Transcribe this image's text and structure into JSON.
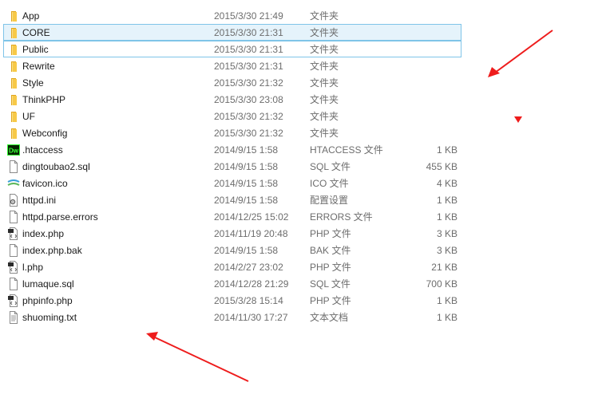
{
  "files": [
    {
      "name": "App",
      "date": "2015/3/30 21:49",
      "type": "文件夹",
      "size": "",
      "icon": "folder-icon"
    },
    {
      "name": "CORE",
      "date": "2015/3/30 21:31",
      "type": "文件夹",
      "size": "",
      "icon": "folder-icon",
      "state": "selected"
    },
    {
      "name": "Public",
      "date": "2015/3/30 21:31",
      "type": "文件夹",
      "size": "",
      "icon": "folder-icon",
      "state": "focused"
    },
    {
      "name": "Rewrite",
      "date": "2015/3/30 21:31",
      "type": "文件夹",
      "size": "",
      "icon": "folder-icon"
    },
    {
      "name": "Style",
      "date": "2015/3/30 21:32",
      "type": "文件夹",
      "size": "",
      "icon": "folder-icon"
    },
    {
      "name": "ThinkPHP",
      "date": "2015/3/30 23:08",
      "type": "文件夹",
      "size": "",
      "icon": "folder-icon"
    },
    {
      "name": "UF",
      "date": "2015/3/30 21:32",
      "type": "文件夹",
      "size": "",
      "icon": "folder-icon"
    },
    {
      "name": "Webconfig",
      "date": "2015/3/30 21:32",
      "type": "文件夹",
      "size": "",
      "icon": "folder-icon"
    },
    {
      "name": ".htaccess",
      "date": "2014/9/15 1:58",
      "type": "HTACCESS 文件",
      "size": "1 KB",
      "icon": "dreamweaver-icon"
    },
    {
      "name": "dingtoubao2.sql",
      "date": "2014/9/15 1:58",
      "type": "SQL 文件",
      "size": "455 KB",
      "icon": "file-icon"
    },
    {
      "name": "favicon.ico",
      "date": "2014/9/15 1:58",
      "type": "ICO 文件",
      "size": "4 KB",
      "icon": "ico-icon"
    },
    {
      "name": "httpd.ini",
      "date": "2014/9/15 1:58",
      "type": "配置设置",
      "size": "1 KB",
      "icon": "settings-file-icon"
    },
    {
      "name": "httpd.parse.errors",
      "date": "2014/12/25 15:02",
      "type": "ERRORS 文件",
      "size": "1 KB",
      "icon": "file-icon"
    },
    {
      "name": "index.php",
      "date": "2014/11/19 20:48",
      "type": "PHP 文件",
      "size": "3 KB",
      "icon": "php-file-icon"
    },
    {
      "name": "index.php.bak",
      "date": "2014/9/15 1:58",
      "type": "BAK 文件",
      "size": "3 KB",
      "icon": "file-icon"
    },
    {
      "name": "l.php",
      "date": "2014/2/27 23:02",
      "type": "PHP 文件",
      "size": "21 KB",
      "icon": "php-file-icon"
    },
    {
      "name": "lumaque.sql",
      "date": "2014/12/28 21:29",
      "type": "SQL 文件",
      "size": "700 KB",
      "icon": "file-icon"
    },
    {
      "name": "phpinfo.php",
      "date": "2015/3/28 15:14",
      "type": "PHP 文件",
      "size": "1 KB",
      "icon": "php-file-icon"
    },
    {
      "name": "shuoming.txt",
      "date": "2014/11/30 17:27",
      "type": "文本文档",
      "size": "1 KB",
      "icon": "text-file-icon"
    }
  ],
  "colors": {
    "annotation": "#ee1c1c",
    "folder": "#f7c948",
    "selection_bg": "#e5f3fb",
    "selection_border": "#7fc4e8"
  }
}
